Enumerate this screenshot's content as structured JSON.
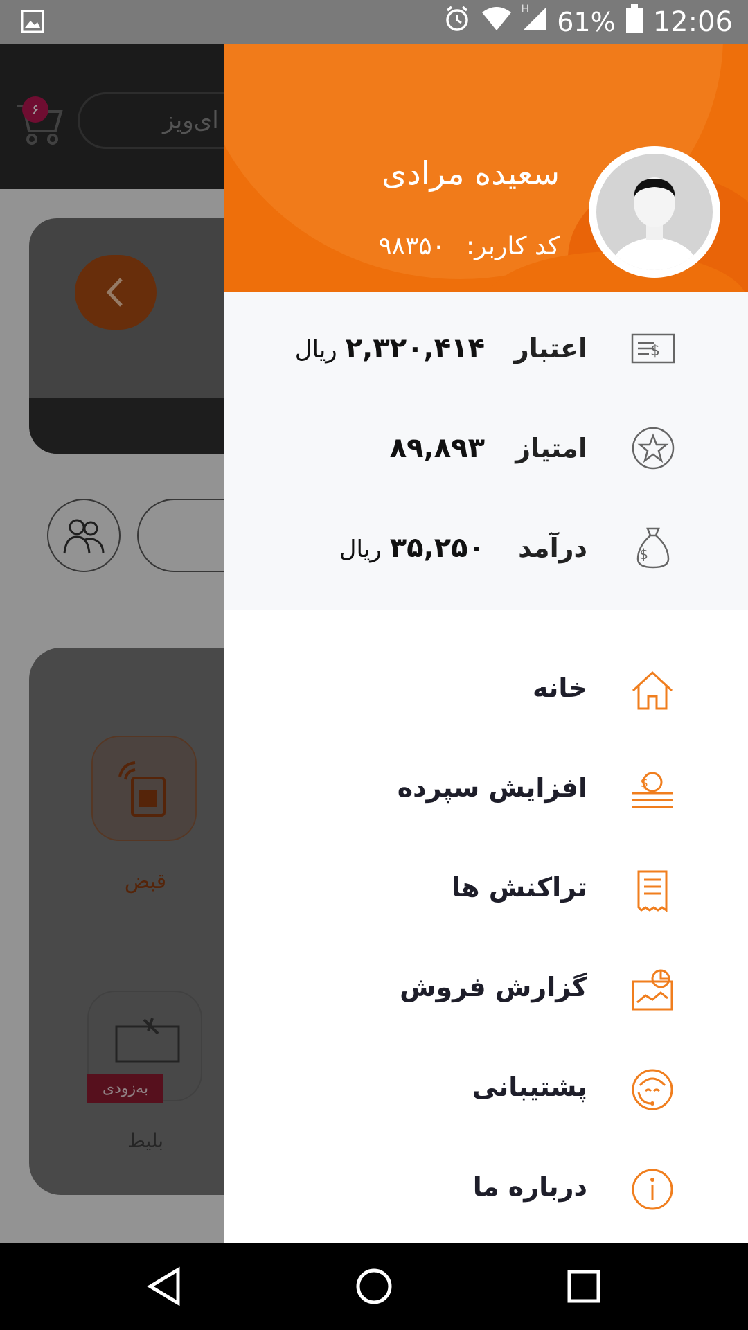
{
  "status_bar": {
    "battery": "61%",
    "time": "12:06",
    "network_type": "H"
  },
  "background": {
    "search_text": "ای‌ویز",
    "cart_badge": "۶",
    "tile1_label": "قبض",
    "tile2_label": "بلیط",
    "tile2_badge": "به‌زودی"
  },
  "drawer": {
    "user": {
      "name": "سعیده مرادی",
      "code_label": "کد کاربر:",
      "code_value": "۹۸۳۵۰"
    },
    "stats": [
      {
        "label": "اعتبار",
        "value": "۲,۳۲۰,۴۱۴",
        "unit": "ریال",
        "icon": "cheque-icon"
      },
      {
        "label": "امتیاز",
        "value": "۸۹,۸۹۳",
        "unit": "",
        "icon": "star-icon"
      },
      {
        "label": "درآمد",
        "value": "۳۵,۲۵۰",
        "unit": "ریال",
        "icon": "money-bag-icon"
      }
    ],
    "menu": [
      {
        "label": "خانه",
        "icon": "home-icon"
      },
      {
        "label": "افزایش سپرده",
        "icon": "deposit-icon"
      },
      {
        "label": "تراکنش ها",
        "icon": "receipt-icon"
      },
      {
        "label": "گزارش فروش",
        "icon": "sales-report-icon"
      },
      {
        "label": "پشتیبانی",
        "icon": "support-icon"
      },
      {
        "label": "درباره ما",
        "icon": "info-icon"
      }
    ]
  },
  "colors": {
    "accent": "#ee6f0b",
    "stats_bg": "#f7f8fa",
    "icon_orange": "#f07e1e"
  }
}
